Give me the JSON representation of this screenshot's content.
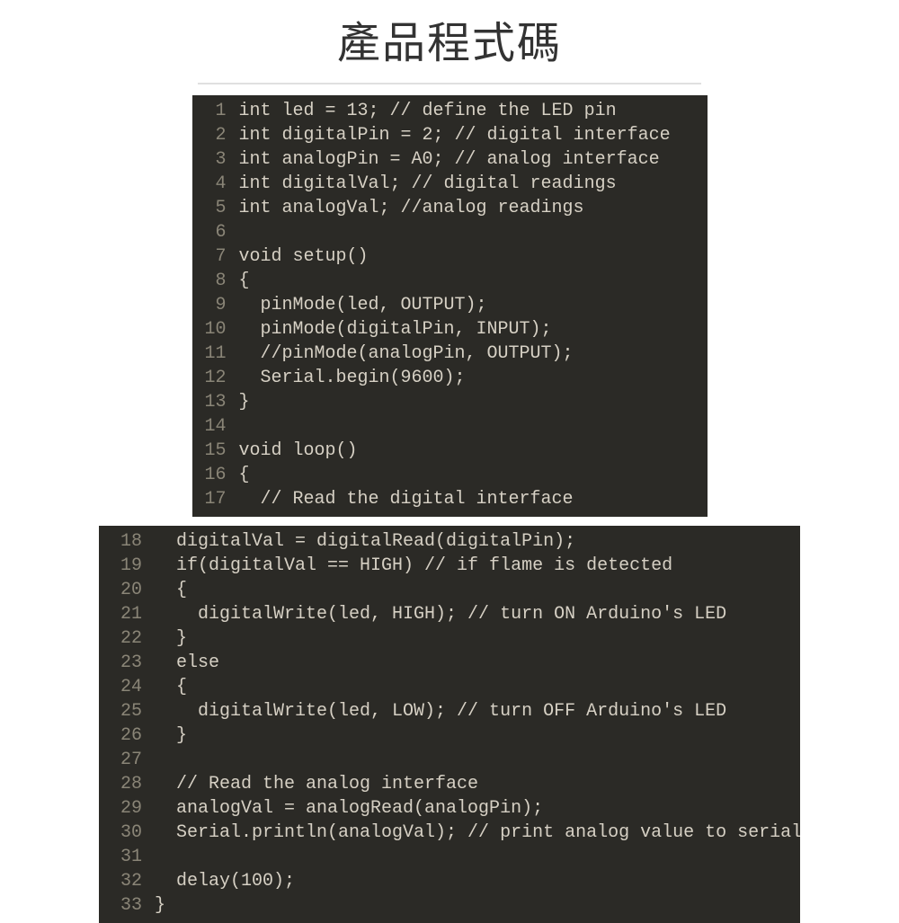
{
  "title": "產品程式碼",
  "block1": {
    "start": 1,
    "lines": [
      "int led = 13; // define the LED pin",
      "int digitalPin = 2; // digital interface",
      "int analogPin = A0; // analog interface",
      "int digitalVal; // digital readings",
      "int analogVal; //analog readings",
      "",
      "void setup()",
      "{",
      "  pinMode(led, OUTPUT);",
      "  pinMode(digitalPin, INPUT);",
      "  //pinMode(analogPin, OUTPUT);",
      "  Serial.begin(9600);",
      "}",
      "",
      "void loop()",
      "{",
      "  // Read the digital interface"
    ]
  },
  "block2": {
    "start": 18,
    "lines": [
      "  digitalVal = digitalRead(digitalPin);",
      "  if(digitalVal == HIGH) // if flame is detected",
      "  {",
      "    digitalWrite(led, HIGH); // turn ON Arduino's LED",
      "  }",
      "  else",
      "  {",
      "    digitalWrite(led, LOW); // turn OFF Arduino's LED",
      "  }",
      "",
      "  // Read the analog interface",
      "  analogVal = analogRead(analogPin);",
      "  Serial.println(analogVal); // print analog value to serial",
      "",
      "  delay(100);",
      "}"
    ]
  }
}
